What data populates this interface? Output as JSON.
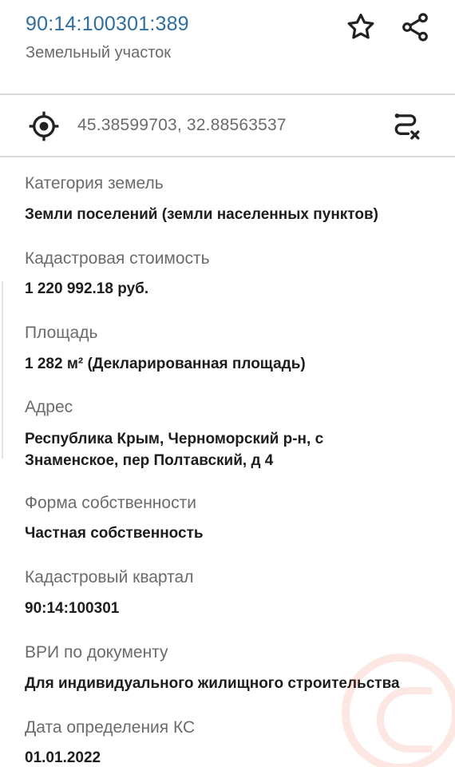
{
  "header": {
    "cadastral_number": "90:14:100301:389",
    "object_type": "Земельный участок",
    "favorite_icon": "star-outline-icon",
    "share_icon": "share-icon"
  },
  "location": {
    "locate_icon": "crosshair-icon",
    "coordinates": "45.38599703, 32.88563537",
    "route_icon": "route-cancel-icon"
  },
  "properties": [
    {
      "label": "Категория земель",
      "value": "Земли поселений (земли населенных пунктов)"
    },
    {
      "label": "Кадастровая стоимость",
      "value": "1 220 992.18 руб."
    },
    {
      "label": "Площадь",
      "value": "1 282 м² (Декларированная площадь)"
    },
    {
      "label": "Адрес",
      "value": "Республика Крым, Черноморский р-н, с Знаменское, пер Полтавский, д 4"
    },
    {
      "label": "Форма собственности",
      "value": "Частная собственность"
    },
    {
      "label": "Кадастровый квартал",
      "value": "90:14:100301"
    },
    {
      "label": "ВРИ по документу",
      "value": "Для индивидуального жилищного строительства"
    },
    {
      "label": "Дата определения КС",
      "value": "01.01.2022"
    }
  ],
  "colors": {
    "accent": "#2f6f9f",
    "label": "#6b6b6b",
    "value": "#1d1d1d",
    "divider": "#d9d9d9"
  }
}
